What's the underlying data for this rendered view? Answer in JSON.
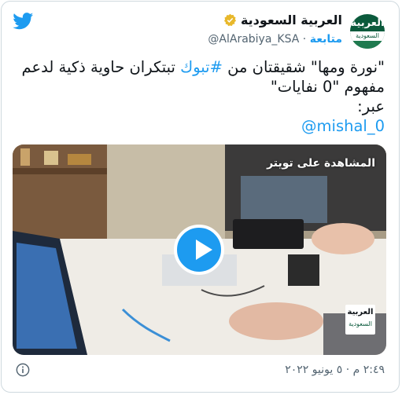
{
  "account": {
    "display_name": "العربية السعودية",
    "handle": "@AlArabiya_KSA",
    "separator": "·",
    "follow_label": "متابعة",
    "avatar_logo": "العربية",
    "avatar_sub": "السعودية"
  },
  "tweet": {
    "line1_prefix": "\"نورة ومها\" شقيقتان من ",
    "hashtag": "#تبوك",
    "line1_suffix": " تبتكران حاوية ذكية لدعم",
    "line2": "مفهوم \"0 نفايات\"",
    "line3": "عبر:",
    "mention": "@mishal_0"
  },
  "media": {
    "watch_label": "المشاهدة على تويتر",
    "corner_logo": "العربية",
    "corner_sub": "السعودية"
  },
  "footer": {
    "timestamp": "٢:٤٩ م · ٥ يونيو ٢٠٢٢"
  },
  "colors": {
    "accent": "#1d9bf0",
    "text": "#0f1419",
    "muted": "#536471",
    "verified_gold": "#e8b82b"
  },
  "icons": [
    "twitter-bird-icon",
    "verified-badge-icon",
    "play-icon",
    "info-icon"
  ]
}
